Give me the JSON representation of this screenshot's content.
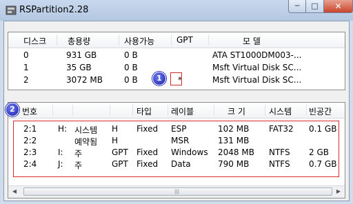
{
  "window": {
    "title": "RSPartition2.28",
    "controls": {
      "minimize": "─",
      "maximize": "□",
      "close": "✕"
    }
  },
  "disks": {
    "columns": [
      "디스크",
      "총용량",
      "사용가능",
      "GPT",
      "모  델"
    ],
    "rows": [
      {
        "disk": "0",
        "total": "931 GB",
        "free": "0 B",
        "gpt": "",
        "model": "ATA ST1000DM003-..."
      },
      {
        "disk": "1",
        "total": "35 GB",
        "free": "0 B",
        "gpt": "",
        "model": "Msft Virtual Disk SC..."
      },
      {
        "disk": "2",
        "total": "3072 MB",
        "free": "0 B",
        "gpt": "*",
        "model": "Msft Virtual Disk SC..."
      }
    ]
  },
  "partitions": {
    "columns": [
      "번호",
      "",
      "",
      "",
      "타입",
      "레이블",
      "크 기",
      "시스템",
      "빈공간"
    ],
    "rows": [
      {
        "num": "2:1",
        "drive": "H:",
        "name": "시스템",
        "flag": "H",
        "type": "Fixed",
        "label": "ESP",
        "size": "102 MB",
        "fs": "FAT32",
        "free": "0.1 GB"
      },
      {
        "num": "2:2",
        "drive": "",
        "name": "예약됨",
        "flag": "H",
        "type": "",
        "label": "MSR",
        "size": "131 MB",
        "fs": "",
        "free": ""
      },
      {
        "num": "2:3",
        "drive": "I:",
        "name": "주",
        "flag": "GPT",
        "type": "Fixed",
        "label": "Windows",
        "size": "2048 MB",
        "fs": "NTFS",
        "free": "2 GB"
      },
      {
        "num": "2:4",
        "drive": "J:",
        "name": "주",
        "flag": "GPT",
        "type": "Fixed",
        "label": "Data",
        "size": "790 MB",
        "fs": "NTFS",
        "free": "0.7 GB"
      }
    ]
  },
  "annotations": {
    "badge1": "1",
    "badge2": "2"
  },
  "colors": {
    "highlight": "#d82a2a",
    "badge": "#1a1fa8"
  },
  "scrollbar": {
    "left_arrow": "◀",
    "right_arrow": "▶",
    "grip": "|||"
  }
}
